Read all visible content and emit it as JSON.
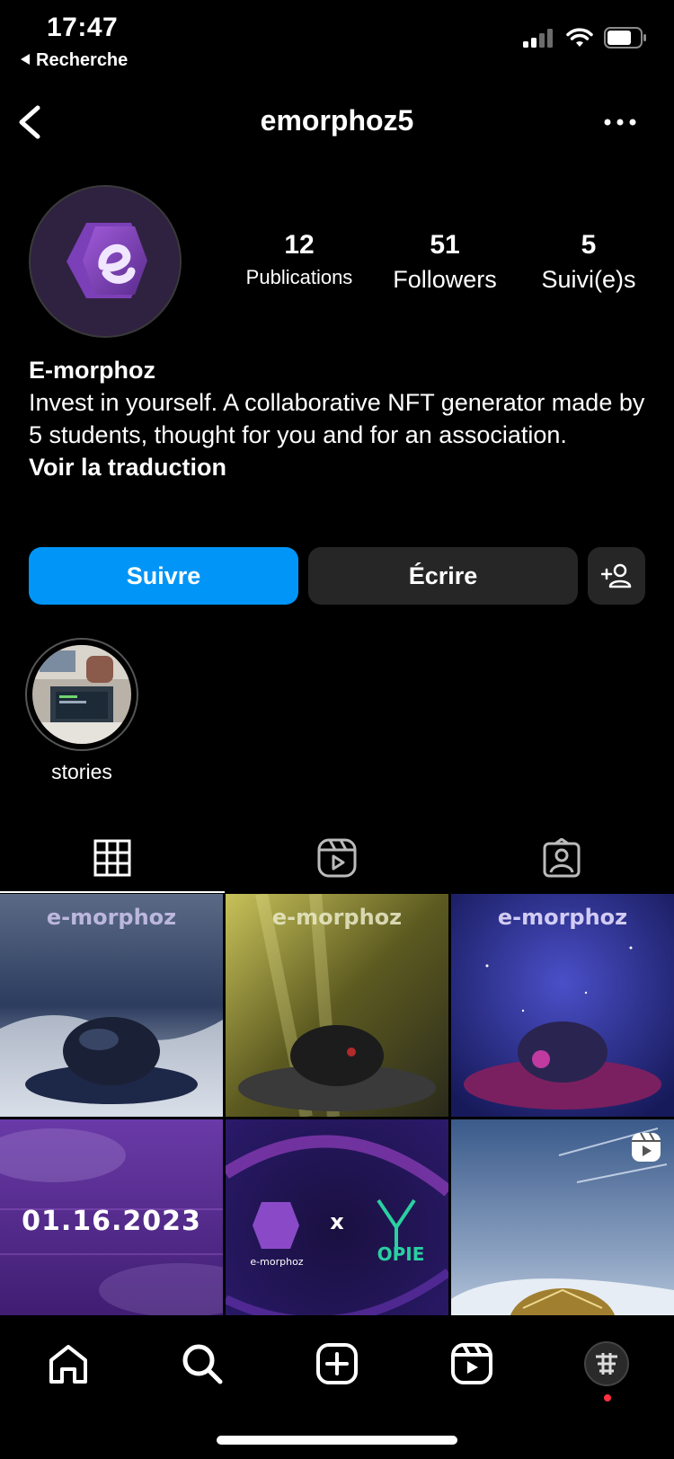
{
  "status_bar": {
    "time": "17:47",
    "back_app": "Recherche"
  },
  "header": {
    "username": "emorphoz5",
    "back_icon": "chevron-left-icon",
    "more_icon": "more-horizontal-icon"
  },
  "profile": {
    "stats": [
      {
        "number": "12",
        "label": "Publications"
      },
      {
        "number": "51",
        "label": "Followers"
      },
      {
        "number": "5",
        "label": "Suivi(e)s"
      }
    ],
    "name": "E-morphoz",
    "bio": "Invest in yourself. A collaborative NFT generator made by 5 students, thought for you and for an association.",
    "translate": "Voir la traduction"
  },
  "actions": {
    "follow": "Suivre",
    "message": "Écrire",
    "suggest_icon": "add-person-icon"
  },
  "highlights": [
    {
      "label": "stories"
    }
  ],
  "tabs": [
    "grid-icon",
    "reels-icon",
    "tagged-icon"
  ],
  "posts": [
    {
      "theme": "ocean",
      "logo_text": "e-morphoz"
    },
    {
      "theme": "forest",
      "logo_text": "e-morphoz"
    },
    {
      "theme": "space",
      "logo_text": "e-morphoz"
    },
    {
      "theme": "purple-clouds",
      "date_text": "01.16.2023"
    },
    {
      "theme": "collab",
      "logo_text": "e-morphoz",
      "cross": "x",
      "partner": "OPIE"
    },
    {
      "theme": "aurora",
      "badge": "reels-icon"
    }
  ],
  "bottom_nav": [
    "home-icon",
    "search-icon",
    "new-post-icon",
    "reels-icon",
    "profile-avatar"
  ],
  "colors": {
    "accent": "#0095f6",
    "secondary_button": "#262626",
    "notification_dot": "#ff3040"
  }
}
